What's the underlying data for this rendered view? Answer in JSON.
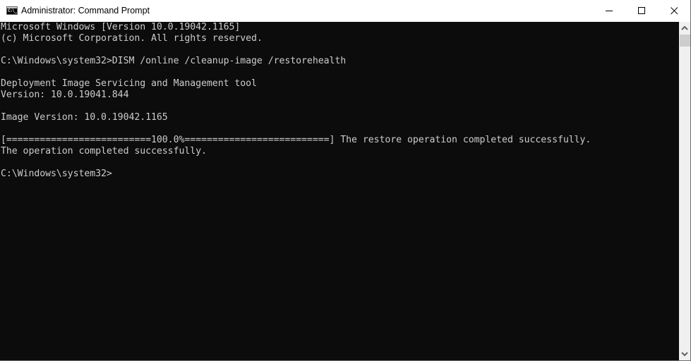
{
  "window": {
    "title": "Administrator: Command Prompt",
    "icon": "cmd-icon",
    "icon_glyph": "C:\\_",
    "controls": [
      "minimize",
      "maximize",
      "close"
    ]
  },
  "console": {
    "lines": [
      "Microsoft Windows [Version 10.0.19042.1165]",
      "(c) Microsoft Corporation. All rights reserved.",
      "",
      "C:\\Windows\\system32>DISM /online /cleanup-image /restorehealth",
      "",
      "Deployment Image Servicing and Management tool",
      "Version: 10.0.19041.844",
      "",
      "Image Version: 10.0.19042.1165",
      "",
      "[==========================100.0%==========================] The restore operation completed successfully.",
      "The operation completed successfully.",
      "",
      "C:\\Windows\\system32>"
    ],
    "progress_percent": 100.0,
    "prompt": "C:\\Windows\\system32>",
    "command": "DISM /online /cleanup-image /restorehealth"
  },
  "colors": {
    "console_bg": "#0c0c0c",
    "console_fg": "#cccccc",
    "titlebar_bg": "#ffffff",
    "scrollbar_track": "#f0f0f0",
    "scrollbar_thumb": "#cdcdcd"
  }
}
